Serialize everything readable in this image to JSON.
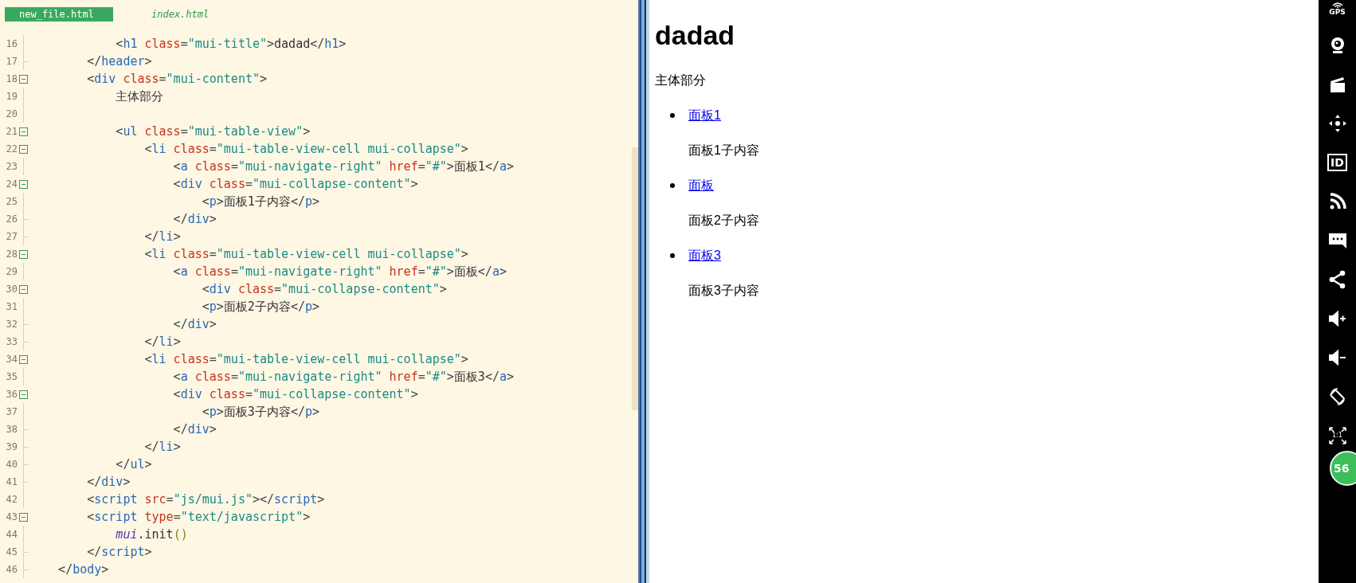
{
  "editor": {
    "tabs": [
      {
        "label": "new_file.html",
        "selected": true
      },
      {
        "label": "index.html",
        "selected": false
      }
    ],
    "lines": [
      {
        "number": "16",
        "kind": "plain",
        "tokens": [
          {
            "kind": "punct",
            "text": "            <"
          },
          {
            "kind": "tag",
            "text": "h1"
          },
          {
            "kind": "attr",
            "text": " class"
          },
          {
            "kind": "punct",
            "text": "="
          },
          {
            "kind": "string",
            "text": "\"mui-title\""
          },
          {
            "kind": "punct",
            "text": ">"
          },
          {
            "kind": "content",
            "text": "dadad"
          },
          {
            "kind": "punct",
            "text": "</"
          },
          {
            "kind": "tag",
            "text": "h1"
          },
          {
            "kind": "punct",
            "text": ">"
          }
        ]
      },
      {
        "number": "17",
        "kind": "fold-end",
        "tokens": [
          {
            "kind": "punct",
            "text": "        </"
          },
          {
            "kind": "tag",
            "text": "header"
          },
          {
            "kind": "punct",
            "text": ">"
          }
        ]
      },
      {
        "number": "18",
        "kind": "fold-start",
        "tokens": [
          {
            "kind": "punct",
            "text": "        <"
          },
          {
            "kind": "tag",
            "text": "div"
          },
          {
            "kind": "attr",
            "text": " class"
          },
          {
            "kind": "punct",
            "text": "="
          },
          {
            "kind": "string",
            "text": "\"mui-content\""
          },
          {
            "kind": "punct",
            "text": ">"
          }
        ]
      },
      {
        "number": "19",
        "kind": "plain",
        "tokens": [
          {
            "kind": "content",
            "text": "            主体部分"
          }
        ]
      },
      {
        "number": "20",
        "kind": "plain"
      },
      {
        "number": "21",
        "kind": "fold-start",
        "tokens": [
          {
            "kind": "punct",
            "text": "            <"
          },
          {
            "kind": "tag",
            "text": "ul"
          },
          {
            "kind": "attr",
            "text": " class"
          },
          {
            "kind": "punct",
            "text": "="
          },
          {
            "kind": "string",
            "text": "\"mui-table-view\""
          },
          {
            "kind": "punct",
            "text": ">"
          }
        ]
      },
      {
        "number": "22",
        "kind": "fold-start",
        "tokens": [
          {
            "kind": "punct",
            "text": "                <"
          },
          {
            "kind": "tag",
            "text": "li"
          },
          {
            "kind": "attr",
            "text": " class"
          },
          {
            "kind": "punct",
            "text": "="
          },
          {
            "kind": "string",
            "text": "\"mui-table-view-cell mui-collapse\""
          },
          {
            "kind": "punct",
            "text": ">"
          }
        ]
      },
      {
        "number": "23",
        "kind": "plain",
        "tokens": [
          {
            "kind": "punct",
            "text": "                    <"
          },
          {
            "kind": "tag",
            "text": "a"
          },
          {
            "kind": "attr",
            "text": " class"
          },
          {
            "kind": "punct",
            "text": "="
          },
          {
            "kind": "string",
            "text": "\"mui-navigate-right\""
          },
          {
            "kind": "attr",
            "text": " href"
          },
          {
            "kind": "punct",
            "text": "="
          },
          {
            "kind": "string",
            "text": "\"#\""
          },
          {
            "kind": "punct",
            "text": ">"
          },
          {
            "kind": "content",
            "text": "面板1"
          },
          {
            "kind": "punct",
            "text": "</"
          },
          {
            "kind": "tag",
            "text": "a"
          },
          {
            "kind": "punct",
            "text": ">"
          }
        ]
      },
      {
        "number": "24",
        "kind": "fold-start",
        "tokens": [
          {
            "kind": "punct",
            "text": "                    <"
          },
          {
            "kind": "tag",
            "text": "div"
          },
          {
            "kind": "attr",
            "text": " class"
          },
          {
            "kind": "punct",
            "text": "="
          },
          {
            "kind": "string",
            "text": "\"mui-collapse-content\""
          },
          {
            "kind": "punct",
            "text": ">"
          }
        ]
      },
      {
        "number": "25",
        "kind": "plain",
        "tokens": [
          {
            "kind": "punct",
            "text": "                        <"
          },
          {
            "kind": "tag",
            "text": "p"
          },
          {
            "kind": "punct",
            "text": ">"
          },
          {
            "kind": "content",
            "text": "面板1子内容"
          },
          {
            "kind": "punct",
            "text": "</"
          },
          {
            "kind": "tag",
            "text": "p"
          },
          {
            "kind": "punct",
            "text": ">"
          }
        ]
      },
      {
        "number": "26",
        "kind": "fold-end",
        "tokens": [
          {
            "kind": "punct",
            "text": "                    </"
          },
          {
            "kind": "tag",
            "text": "div"
          },
          {
            "kind": "punct",
            "text": ">"
          }
        ]
      },
      {
        "number": "27",
        "kind": "fold-end",
        "tokens": [
          {
            "kind": "punct",
            "text": "                </"
          },
          {
            "kind": "tag",
            "text": "li"
          },
          {
            "kind": "punct",
            "text": ">"
          }
        ]
      },
      {
        "number": "28",
        "kind": "fold-start",
        "tokens": [
          {
            "kind": "punct",
            "text": "                <"
          },
          {
            "kind": "tag",
            "text": "li"
          },
          {
            "kind": "attr",
            "text": " class"
          },
          {
            "kind": "punct",
            "text": "="
          },
          {
            "kind": "string",
            "text": "\"mui-table-view-cell mui-collapse\""
          },
          {
            "kind": "punct",
            "text": ">"
          }
        ]
      },
      {
        "number": "29",
        "kind": "plain",
        "tokens": [
          {
            "kind": "punct",
            "text": "                    <"
          },
          {
            "kind": "tag",
            "text": "a"
          },
          {
            "kind": "attr",
            "text": " class"
          },
          {
            "kind": "punct",
            "text": "="
          },
          {
            "kind": "string",
            "text": "\"mui-navigate-right\""
          },
          {
            "kind": "attr",
            "text": " href"
          },
          {
            "kind": "punct",
            "text": "="
          },
          {
            "kind": "string",
            "text": "\"#\""
          },
          {
            "kind": "punct",
            "text": ">"
          },
          {
            "kind": "content",
            "text": "面板"
          },
          {
            "kind": "punct",
            "text": "</"
          },
          {
            "kind": "tag",
            "text": "a"
          },
          {
            "kind": "punct",
            "text": ">"
          }
        ]
      },
      {
        "number": "30",
        "kind": "fold-start",
        "tokens": [
          {
            "kind": "punct",
            "text": "                        <"
          },
          {
            "kind": "tag",
            "text": "div"
          },
          {
            "kind": "attr",
            "text": " class"
          },
          {
            "kind": "punct",
            "text": "="
          },
          {
            "kind": "string",
            "text": "\"mui-collapse-content\""
          },
          {
            "kind": "punct",
            "text": ">"
          }
        ]
      },
      {
        "number": "31",
        "kind": "plain",
        "tokens": [
          {
            "kind": "punct",
            "text": "                        <"
          },
          {
            "kind": "tag",
            "text": "p"
          },
          {
            "kind": "punct",
            "text": ">"
          },
          {
            "kind": "content",
            "text": "面板2子内容"
          },
          {
            "kind": "punct",
            "text": "</"
          },
          {
            "kind": "tag",
            "text": "p"
          },
          {
            "kind": "punct",
            "text": ">"
          }
        ]
      },
      {
        "number": "32",
        "kind": "fold-end",
        "tokens": [
          {
            "kind": "punct",
            "text": "                    </"
          },
          {
            "kind": "tag",
            "text": "div"
          },
          {
            "kind": "punct",
            "text": ">"
          }
        ]
      },
      {
        "number": "33",
        "kind": "fold-end",
        "tokens": [
          {
            "kind": "punct",
            "text": "                </"
          },
          {
            "kind": "tag",
            "text": "li"
          },
          {
            "kind": "punct",
            "text": ">"
          }
        ]
      },
      {
        "number": "34",
        "kind": "fold-start",
        "tokens": [
          {
            "kind": "punct",
            "text": "                <"
          },
          {
            "kind": "tag",
            "text": "li"
          },
          {
            "kind": "attr",
            "text": " class"
          },
          {
            "kind": "punct",
            "text": "="
          },
          {
            "kind": "string",
            "text": "\"mui-table-view-cell mui-collapse\""
          },
          {
            "kind": "punct",
            "text": ">"
          }
        ]
      },
      {
        "number": "35",
        "kind": "plain",
        "tokens": [
          {
            "kind": "punct",
            "text": "                    <"
          },
          {
            "kind": "tag",
            "text": "a"
          },
          {
            "kind": "attr",
            "text": " class"
          },
          {
            "kind": "punct",
            "text": "="
          },
          {
            "kind": "string",
            "text": "\"mui-navigate-right\""
          },
          {
            "kind": "attr",
            "text": " href"
          },
          {
            "kind": "punct",
            "text": "="
          },
          {
            "kind": "string",
            "text": "\"#\""
          },
          {
            "kind": "punct",
            "text": ">"
          },
          {
            "kind": "content",
            "text": "面板3"
          },
          {
            "kind": "punct",
            "text": "</"
          },
          {
            "kind": "tag",
            "text": "a"
          },
          {
            "kind": "punct",
            "text": ">"
          }
        ]
      },
      {
        "number": "36",
        "kind": "fold-start",
        "tokens": [
          {
            "kind": "punct",
            "text": "                    <"
          },
          {
            "kind": "tag",
            "text": "div"
          },
          {
            "kind": "attr",
            "text": " class"
          },
          {
            "kind": "punct",
            "text": "="
          },
          {
            "kind": "string",
            "text": "\"mui-collapse-content\""
          },
          {
            "kind": "punct",
            "text": ">"
          }
        ]
      },
      {
        "number": "37",
        "kind": "plain",
        "tokens": [
          {
            "kind": "punct",
            "text": "                        <"
          },
          {
            "kind": "tag",
            "text": "p"
          },
          {
            "kind": "punct",
            "text": ">"
          },
          {
            "kind": "content",
            "text": "面板3子内容"
          },
          {
            "kind": "punct",
            "text": "</"
          },
          {
            "kind": "tag",
            "text": "p"
          },
          {
            "kind": "punct",
            "text": ">"
          }
        ]
      },
      {
        "number": "38",
        "kind": "fold-end",
        "tokens": [
          {
            "kind": "punct",
            "text": "                    </"
          },
          {
            "kind": "tag",
            "text": "div"
          },
          {
            "kind": "punct",
            "text": ">"
          }
        ]
      },
      {
        "number": "39",
        "kind": "fold-end",
        "tokens": [
          {
            "kind": "punct",
            "text": "                </"
          },
          {
            "kind": "tag",
            "text": "li"
          },
          {
            "kind": "punct",
            "text": ">"
          }
        ]
      },
      {
        "number": "40",
        "kind": "fold-end",
        "tokens": [
          {
            "kind": "punct",
            "text": "            </"
          },
          {
            "kind": "tag",
            "text": "ul"
          },
          {
            "kind": "punct",
            "text": ">"
          }
        ]
      },
      {
        "number": "41",
        "kind": "fold-end",
        "tokens": [
          {
            "kind": "punct",
            "text": "        </"
          },
          {
            "kind": "tag",
            "text": "div"
          },
          {
            "kind": "punct",
            "text": ">"
          }
        ]
      },
      {
        "number": "42",
        "kind": "plain",
        "tokens": [
          {
            "kind": "punct",
            "text": "        <"
          },
          {
            "kind": "tag",
            "text": "script"
          },
          {
            "kind": "attr",
            "text": " src"
          },
          {
            "kind": "punct",
            "text": "="
          },
          {
            "kind": "string",
            "text": "\"js/mui.js\""
          },
          {
            "kind": "punct",
            "text": "></"
          },
          {
            "kind": "tag",
            "text": "script"
          },
          {
            "kind": "punct",
            "text": ">"
          }
        ]
      },
      {
        "number": "43",
        "kind": "fold-start",
        "tokens": [
          {
            "kind": "punct",
            "text": "        <"
          },
          {
            "kind": "tag",
            "text": "script"
          },
          {
            "kind": "attr",
            "text": " type"
          },
          {
            "kind": "punct",
            "text": "="
          },
          {
            "kind": "string",
            "text": "\"text/javascript\""
          },
          {
            "kind": "punct",
            "text": ">"
          }
        ]
      },
      {
        "number": "44",
        "kind": "plain",
        "tokens": [
          {
            "kind": "variable",
            "text": "            mui"
          },
          {
            "kind": "content",
            "text": ".init"
          },
          {
            "kind": "paren",
            "text": "()"
          }
        ]
      },
      {
        "number": "45",
        "kind": "fold-end",
        "tokens": [
          {
            "kind": "punct",
            "text": "        </"
          },
          {
            "kind": "tag",
            "text": "script"
          },
          {
            "kind": "punct",
            "text": ">"
          }
        ]
      },
      {
        "number": "46",
        "kind": "fold-end",
        "tokens": [
          {
            "kind": "punct",
            "text": "    </"
          },
          {
            "kind": "tag",
            "text": "body"
          },
          {
            "kind": "punct",
            "text": ">"
          }
        ]
      }
    ]
  },
  "preview": {
    "heading": "dadad",
    "body_text": "主体部分",
    "panels": [
      {
        "link": "面板1",
        "content": "面板1子内容"
      },
      {
        "link": "面板",
        "content": "面板2子内容"
      },
      {
        "link": "面板3",
        "content": "面板3子内容"
      }
    ]
  },
  "emulator_toolbar": {
    "items": [
      {
        "kind": "gps",
        "label": "GPS"
      },
      {
        "kind": "webcam"
      },
      {
        "kind": "clapper"
      },
      {
        "kind": "dpad"
      },
      {
        "kind": "id",
        "label": "ID"
      },
      {
        "kind": "rss"
      },
      {
        "kind": "chat"
      },
      {
        "kind": "share"
      },
      {
        "kind": "volume-up"
      },
      {
        "kind": "volume-down"
      },
      {
        "kind": "rotate"
      },
      {
        "kind": "fit",
        "label": "1:1"
      }
    ],
    "badge": "56"
  }
}
